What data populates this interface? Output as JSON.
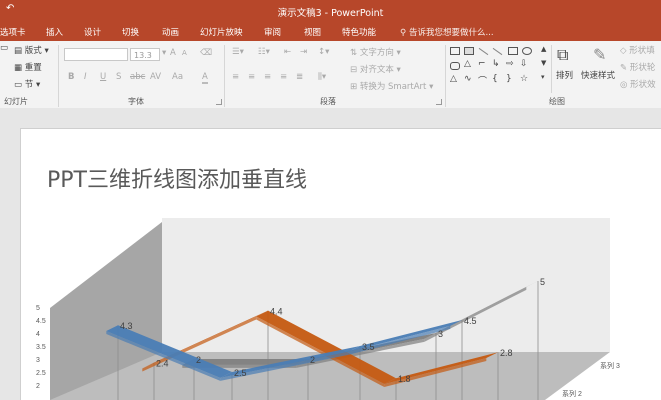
{
  "app": {
    "title": "演示文稿3 - PowerPoint",
    "undo_glyph": "↶"
  },
  "tabs": [
    "选项卡",
    "插入",
    "设计",
    "切换",
    "动画",
    "幻灯片放映",
    "审阅",
    "视图",
    "特色功能"
  ],
  "tell_me": "告诉我您想要做什么...",
  "ribbon": {
    "slides": {
      "layout": "版式",
      "reset": "重置",
      "section": "节",
      "label": "幻灯片"
    },
    "font": {
      "size": "13.3",
      "label": "字体",
      "bold": "B",
      "italic": "I",
      "underline": "U",
      "strike": "S",
      "shadow": "abc",
      "spacing": "AV",
      "grow": "A",
      "shrink": "A",
      "case": "Aa",
      "clear": "A",
      "color": "A"
    },
    "paragraph": {
      "text_direction": "文字方向",
      "align_text": "对齐文本",
      "smartart": "转换为 SmartArt",
      "label": "段落"
    },
    "drawing": {
      "arrange": "排列",
      "quick_styles": "快速样式",
      "shape_fill": "形状填",
      "shape_outline": "形状轮",
      "shape_effects": "形状效",
      "label": "绘图"
    }
  },
  "slide": {
    "title": "PPT三维折线图添加垂直线"
  },
  "colors": {
    "accent": "#b7472a",
    "series_gray": "#7f7f7f",
    "series_orange": "#c55a11",
    "series_blue": "#4a7db5"
  },
  "chart_data": {
    "type": "line",
    "subtype": "3d-line",
    "title": "",
    "categories": [
      "",
      "",
      "",
      ""
    ],
    "series": [
      {
        "name": "",
        "values": [
          4.3,
          2.5,
          3.5,
          4.5
        ]
      },
      {
        "name": "",
        "values": [
          2.4,
          4.4,
          1.8,
          2.8
        ]
      },
      {
        "name": "",
        "values": [
          2,
          2,
          3,
          5
        ]
      }
    ],
    "depth_labels": [
      "系列 3",
      "系列 2"
    ],
    "y_ticks": [
      "5",
      "4.5",
      "4",
      "3.5",
      "3",
      "2.5",
      "2",
      "1.5"
    ],
    "ylim": [
      1.5,
      5
    ],
    "drop_lines": true,
    "grid": false
  }
}
